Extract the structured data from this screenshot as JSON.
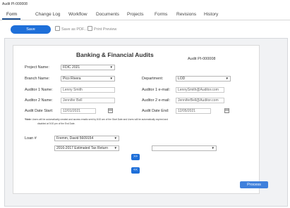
{
  "window": {
    "title": "Audit PI-000008"
  },
  "tabs": [
    {
      "label": "Form"
    },
    {
      "label": "Change Log"
    },
    {
      "label": "Workflow"
    },
    {
      "label": "Documents"
    },
    {
      "label": "Projects"
    },
    {
      "label": "Forms"
    },
    {
      "label": "Revisions"
    },
    {
      "label": "History"
    }
  ],
  "toolbar": {
    "save_label": "Save",
    "save_pdf_label": "Save as PDF...",
    "print_preview_label": "Print Preview"
  },
  "form": {
    "title": "Banking & Financial Audits",
    "audit_id": "Audit PI-000008",
    "project_name_label": "Project Name:",
    "project_name_value": "FDIC 2021",
    "branch_name_label": "Branch Name:",
    "branch_name_value": "Pico Rivera",
    "department_label": "Department:",
    "department_value": "LOD",
    "auditor1_name_label": "Auditor 1 Name:",
    "auditor1_name_value": "Lenny Smith",
    "auditor1_email_label": "Auditor 1 e-mail:",
    "auditor1_email_value": "LennySmith@Auditor.com",
    "auditor2_name_label": "Auditor 2 Name:",
    "auditor2_name_value": "Jennifer Bell",
    "auditor2_email_label": "Auditor 2 e-mail:",
    "auditor2_email_value": "JenniferBell@Auditor.com",
    "start_date_label": "Audit Date Start:",
    "start_date_value": "12/01/2021",
    "end_date_label": "Audit Date End:",
    "end_date_value": "12/05/2021",
    "note_bold": "*Note:",
    "note_text": " Users will be automatically created and access emails sent by 8:00 am of the Start Date and Users will be automatically expired and",
    "note_text2": "disabled at 5:00 pm of the End Date.",
    "loan_label": "Loan #",
    "loan_value": "Fremm, David 5609154",
    "tax_return_value": "2016-2017 Estimated Tax Return",
    "right_select_value": "",
    "move_right_label": ">>",
    "move_left_label": "<<",
    "process_label": "Process"
  }
}
